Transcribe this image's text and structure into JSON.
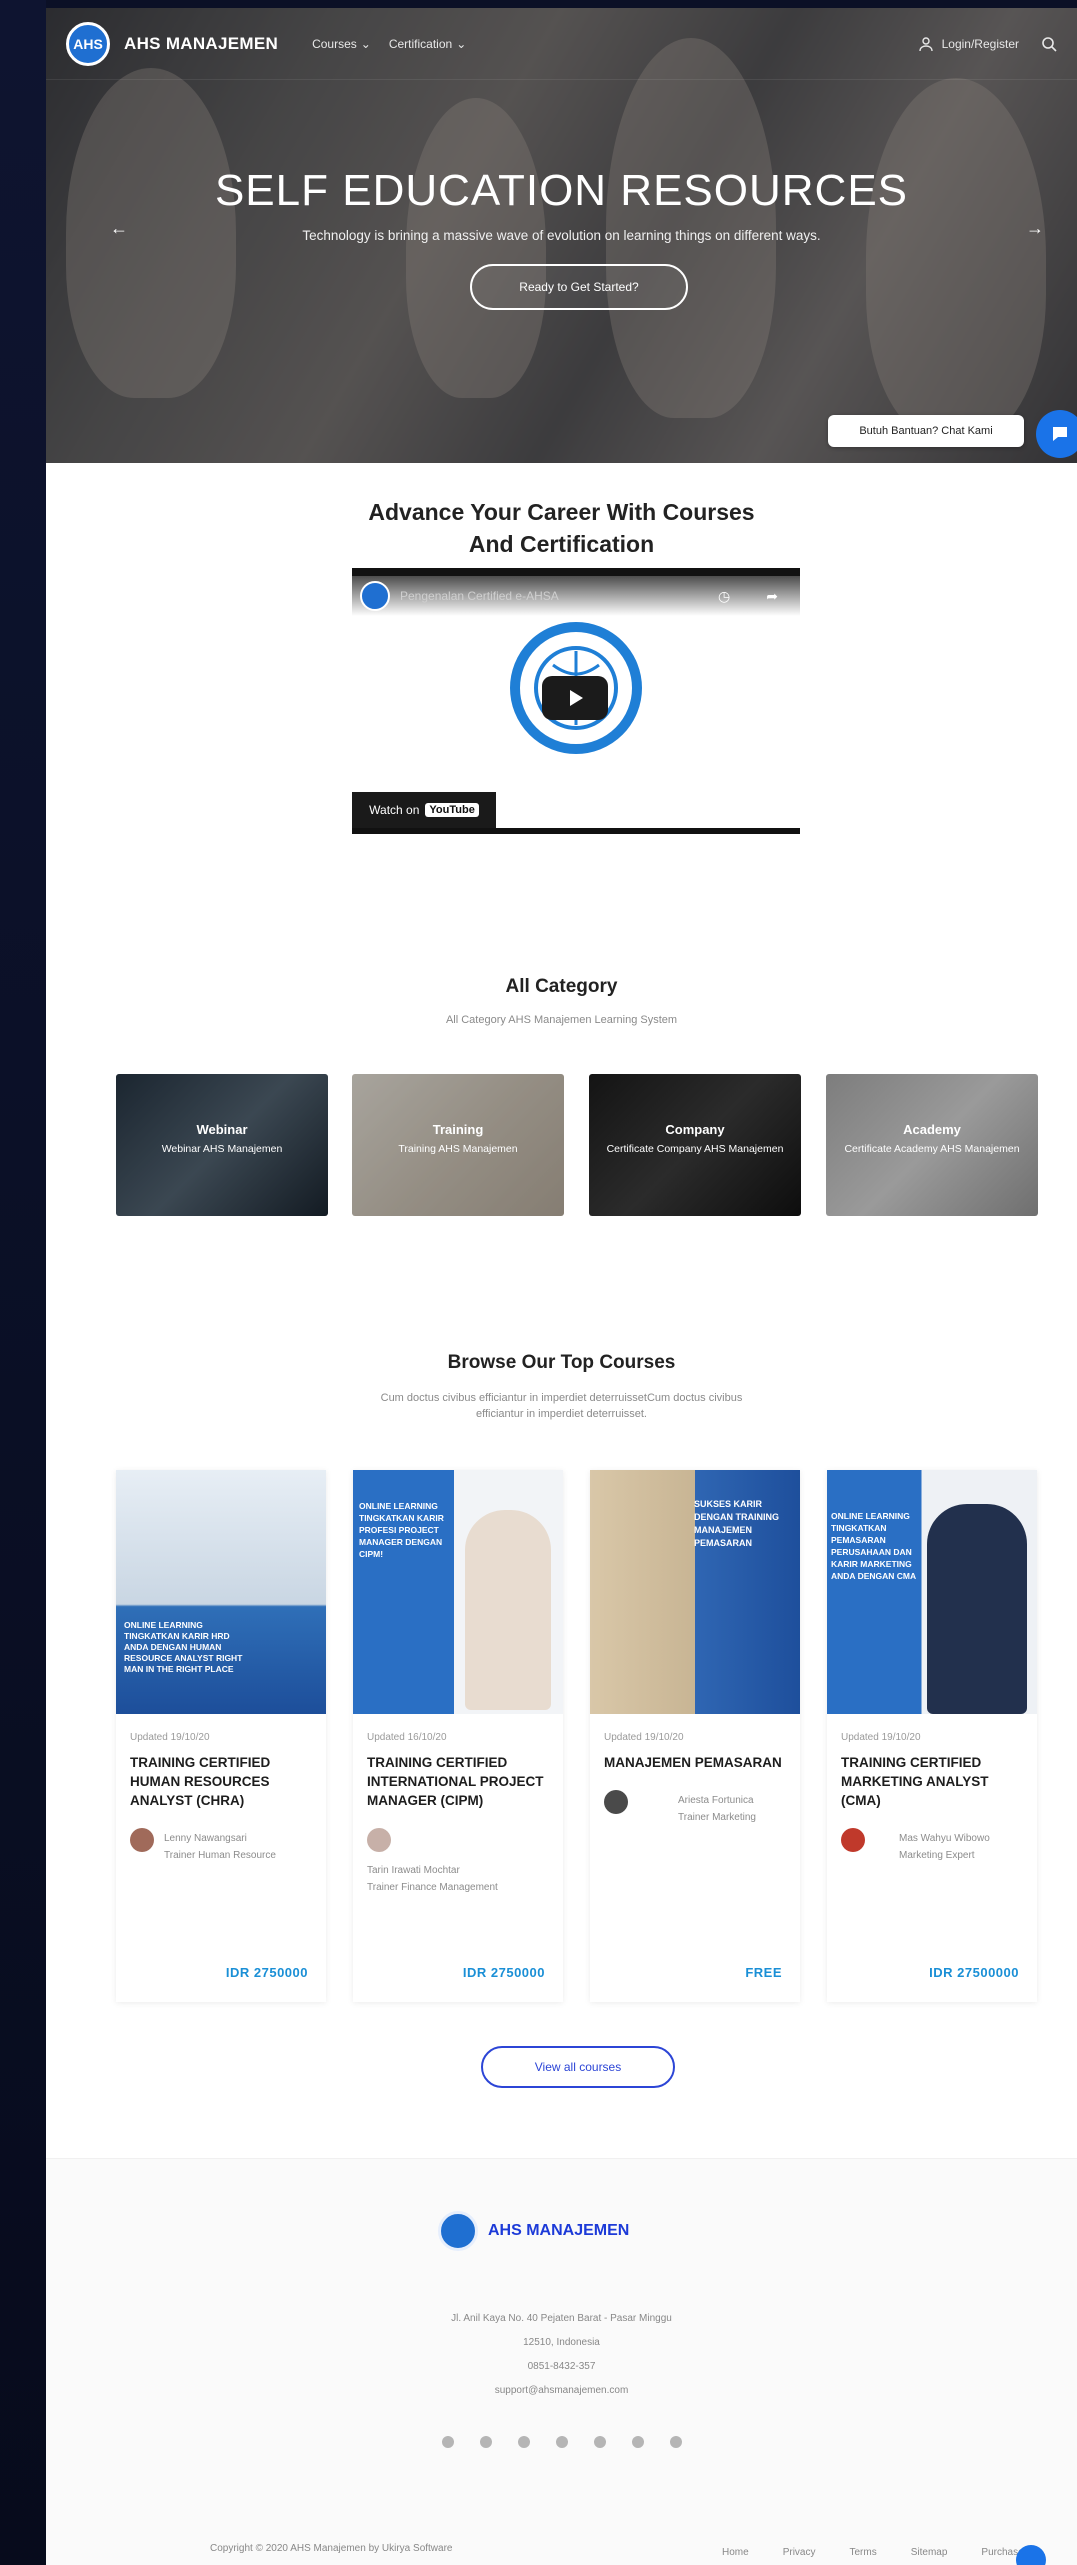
{
  "brand": {
    "name": "AHS MANAJEMEN"
  },
  "nav": {
    "courses": "Courses",
    "certification": "Certification",
    "login": "Login/Register"
  },
  "hero": {
    "title": "SELF EDUCATION RESOURCES",
    "subtitle": "Technology is brining a massive wave of evolution on learning things on different ways.",
    "cta": "Ready to Get Started?"
  },
  "chat": {
    "label": "Butuh Bantuan? Chat Kami"
  },
  "intro": {
    "title_line1": "Advance Your Career With Courses",
    "title_line2": "And Certification"
  },
  "video": {
    "title": "Pengenalan Certified e-AHSA",
    "watch_on": "Watch on",
    "youtube": "YouTube"
  },
  "categories": {
    "title": "All Category",
    "subtitle": "All Category AHS Manajemen Learning System",
    "items": [
      {
        "title": "Webinar",
        "desc": "Webinar AHS Manajemen"
      },
      {
        "title": "Training",
        "desc": "Training AHS Manajemen"
      },
      {
        "title": "Company",
        "desc": "Certificate Company AHS Manajemen"
      },
      {
        "title": "Academy",
        "desc": "Certificate Academy AHS Manajemen"
      }
    ]
  },
  "top_courses": {
    "title": "Browse Our Top Courses",
    "subtitle_line1": "Cum doctus civibus efficiantur in imperdiet deterruissetCum doctus civibus",
    "subtitle_line2": "efficiantur in imperdiet deterruisset.",
    "items": [
      {
        "updated": "Updated 19/10/20",
        "title": "TRAINING CERTIFIED HUMAN RESOURCES ANALYST (CHRA)",
        "trainer_name": "Lenny Nawangsari",
        "trainer_role": "Trainer Human Resource",
        "price": "IDR 2750000",
        "image_text": "ONLINE LEARNING TINGKATKAN KARIR HRD ANDA DENGAN HUMAN RESOURCE ANALYST RIGHT MAN IN THE RIGHT PLACE"
      },
      {
        "updated": "Updated 16/10/20",
        "title": "TRAINING CERTIFIED INTERNATIONAL PROJECT MANAGER (CIPM)",
        "trainer_name": "Tarin Irawati Mochtar",
        "trainer_role": "Trainer Finance Management",
        "price": "IDR 2750000",
        "image_text": "ONLINE LEARNING TINGKATKAN KARIR PROFESI PROJECT MANAGER DENGAN CIPM!"
      },
      {
        "updated": "Updated 19/10/20",
        "title": "MANAJEMEN PEMASARAN",
        "trainer_name": "Ariesta Fortunica",
        "trainer_role": "Trainer Marketing",
        "price": "FREE",
        "image_text": "SUKSES KARIR DENGAN TRAINING MANAJEMEN PEMASARAN"
      },
      {
        "updated": "Updated 19/10/20",
        "title": "TRAINING CERTIFIED MARKETING ANALYST (CMA)",
        "trainer_name": "Mas Wahyu Wibowo",
        "trainer_role": "Marketing Expert",
        "price": "IDR 27500000",
        "image_text": "ONLINE LEARNING TINGKATKAN PEMASARAN PERUSAHAAN DAN KARIR MARKETING ANDA DENGAN CMA"
      }
    ],
    "view_all": "View all courses"
  },
  "footer": {
    "name": "AHS MANAJEMEN",
    "address": "Jl. Anil Kaya No. 40 Pejaten Barat - Pasar Minggu",
    "postcode": "12510, Indonesia",
    "phone": "0851-8432-357",
    "email": "support@ahsmanajemen.com",
    "copyright": "Copyright © 2020 AHS Manajemen by Ukirya Software",
    "links": [
      "Home",
      "Privacy",
      "Terms",
      "Sitemap",
      "Purchase"
    ]
  },
  "colors": {
    "accent": "#1a73e8",
    "brand_blue": "#1c3ad8",
    "price": "#1a8fd6"
  }
}
